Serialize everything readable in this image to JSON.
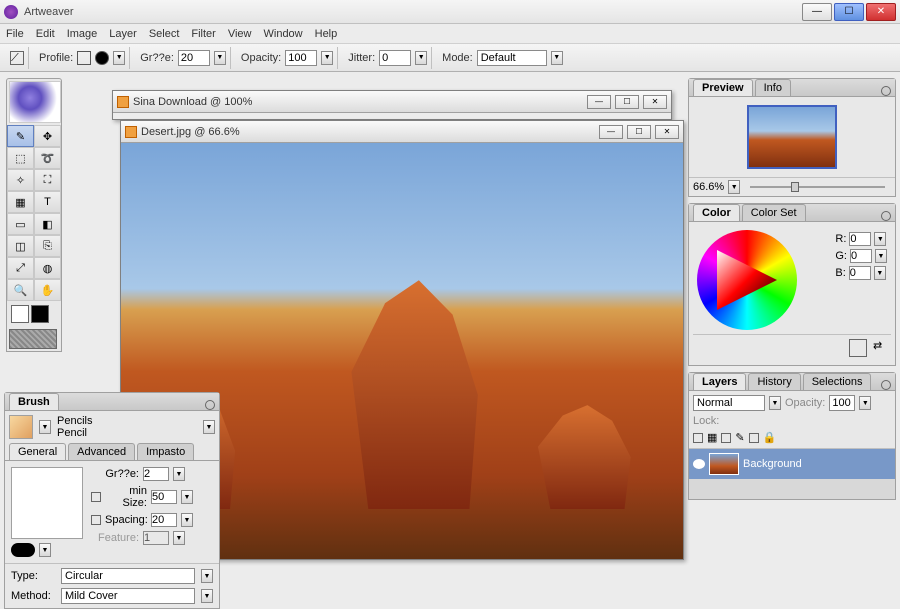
{
  "app": {
    "title": "Artweaver"
  },
  "menu": [
    "File",
    "Edit",
    "Image",
    "Layer",
    "Select",
    "Filter",
    "View",
    "Window",
    "Help"
  ],
  "options": {
    "profile_label": "Profile:",
    "size_label": "Gr??e:",
    "size_value": "20",
    "opacity_label": "Opacity:",
    "opacity_value": "100",
    "jitter_label": "Jitter:",
    "jitter_value": "0",
    "mode_label": "Mode:",
    "mode_value": "Default"
  },
  "documents": {
    "back": {
      "title": "Sina Download @ 100%"
    },
    "front": {
      "title": "Desert.jpg @ 66.6%"
    }
  },
  "preview": {
    "tab1": "Preview",
    "tab2": "Info",
    "zoom": "66.6%"
  },
  "color": {
    "tab1": "Color",
    "tab2": "Color Set",
    "r_label": "R:",
    "r_value": "0",
    "g_label": "G:",
    "g_value": "0",
    "b_label": "B:",
    "b_value": "0"
  },
  "layers": {
    "tab1": "Layers",
    "tab2": "History",
    "tab3": "Selections",
    "blend_mode": "Normal",
    "opacity_label": "Opacity:",
    "opacity_value": "100",
    "lock_label": "Lock:",
    "layer_name": "Background"
  },
  "brush": {
    "panel_title": "Brush",
    "category": "Pencils",
    "preset": "Pencil",
    "sub_general": "General",
    "sub_advanced": "Advanced",
    "sub_impasto": "Impasto",
    "size_label": "Gr??e:",
    "size_value": "2",
    "minsize_label": "min Size:",
    "minsize_value": "50",
    "spacing_label": "Spacing:",
    "spacing_value": "20",
    "feature_label": "Feature:",
    "feature_value": "1",
    "type_label": "Type:",
    "type_value": "Circular",
    "method_label": "Method:",
    "method_value": "Mild Cover"
  }
}
